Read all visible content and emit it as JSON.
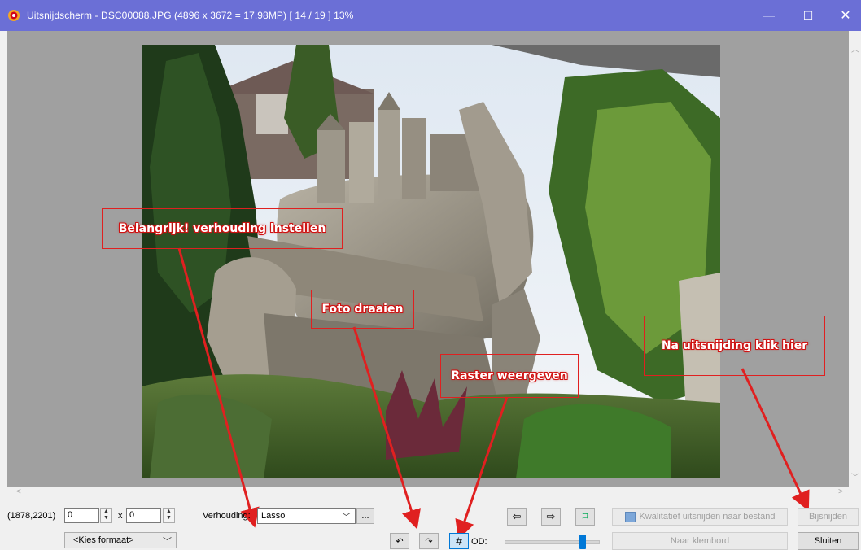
{
  "window": {
    "title": "Uitsnijdscherm  -  DSC00088.JPG  (4896 x 3672 = 17.98MP)  [ 14 / 19 ]  13%",
    "minimize_icon": "minimize-icon",
    "maximize_icon": "maximize-icon",
    "close_icon": "close-icon"
  },
  "annotations": {
    "ratio": "Belangrijk!  verhouding instellen",
    "rotate": "Foto draaien",
    "grid": "Raster weergeven",
    "crop": "Na uitsnijding klik hier",
    "color": "#e02020"
  },
  "controls": {
    "coords": "(1878,2201)",
    "width_value": "0",
    "times": "x",
    "height_value": "0",
    "format_select": "<Kies formaat>",
    "ratio_label": "Verhouding:",
    "ratio_value": "Lasso",
    "more_button": "...",
    "rotate_left": "↶",
    "rotate_right": "↷",
    "grid_button": "#",
    "od_label": "OD:",
    "prev_icon": "⇦",
    "next_icon": "⇨",
    "fit_icon": "⌑",
    "save_crop_label": "Kwalitatief uitsnijden naar bestand",
    "clipboard_label": "Naar klembord",
    "crop_button": "Bijsnijden",
    "close_button": "Sluiten"
  }
}
